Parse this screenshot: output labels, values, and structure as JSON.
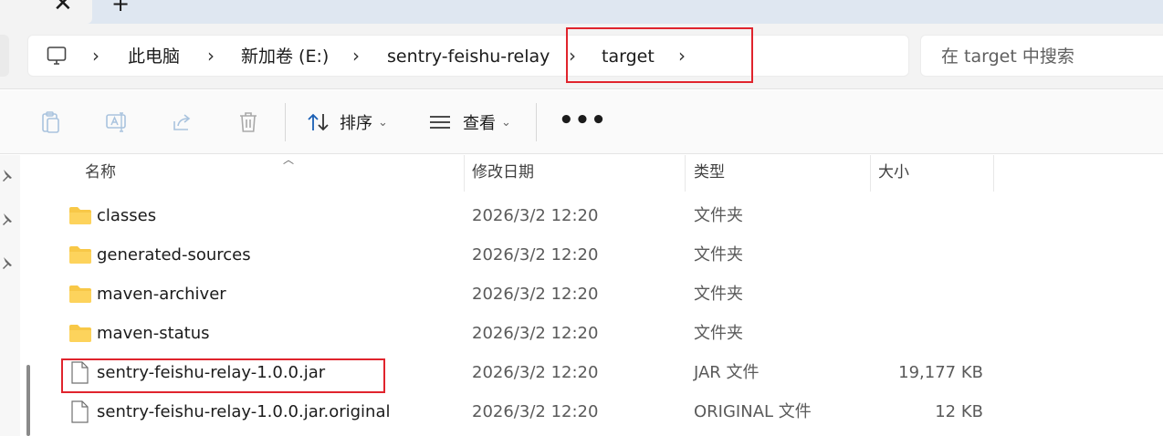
{
  "tabs": {
    "close_glyph": "✕",
    "new_tab_glyph": "+"
  },
  "breadcrumb": {
    "items": [
      "此电脑",
      "新加卷 (E:)",
      "sentry-feishu-relay",
      "target"
    ],
    "separator": "›"
  },
  "search": {
    "placeholder": "在 target 中搜索"
  },
  "toolbar": {
    "sort_label": "排序",
    "view_label": "查看",
    "more_label": "•••",
    "dropdown_glyph": "⌄"
  },
  "columns": {
    "name": "名称",
    "date": "修改日期",
    "type": "类型",
    "size": "大小"
  },
  "files": [
    {
      "name": "classes",
      "date": "2026/3/2 12:20",
      "type": "文件夹",
      "size": "",
      "kind": "folder"
    },
    {
      "name": "generated-sources",
      "date": "2026/3/2 12:20",
      "type": "文件夹",
      "size": "",
      "kind": "folder"
    },
    {
      "name": "maven-archiver",
      "date": "2026/3/2 12:20",
      "type": "文件夹",
      "size": "",
      "kind": "folder"
    },
    {
      "name": "maven-status",
      "date": "2026/3/2 12:20",
      "type": "文件夹",
      "size": "",
      "kind": "folder"
    },
    {
      "name": "sentry-feishu-relay-1.0.0.jar",
      "date": "2026/3/2 12:20",
      "type": "JAR 文件",
      "size": "19,177 KB",
      "kind": "file"
    },
    {
      "name": "sentry-feishu-relay-1.0.0.jar.original",
      "date": "2026/3/2 12:20",
      "type": "ORIGINAL 文件",
      "size": "12 KB",
      "kind": "file"
    }
  ],
  "colors": {
    "highlight": "#e0242d",
    "folder": "#f8c847",
    "tabstrip": "#dfe7f1"
  }
}
